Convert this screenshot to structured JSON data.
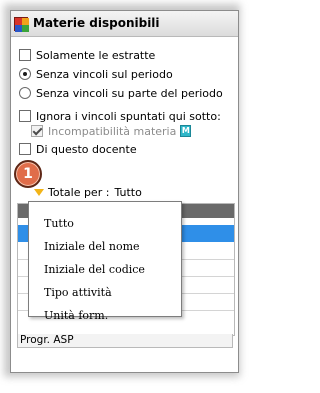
{
  "window": {
    "title": "Materie disponibili",
    "icon": "app-grid-icon"
  },
  "options": {
    "only_drawn": {
      "label": "Solamente le estratte",
      "checked": false
    },
    "radio_period": {
      "label": "Senza vincoli sul periodo",
      "selected": true
    },
    "radio_part_period": {
      "label": "Senza vincoli su parte del periodo",
      "selected": false
    },
    "ignore_constraints": {
      "label": "Ignora i vincoli spuntati qui sotto:",
      "checked": false
    },
    "incompatibility": {
      "label": "Incompatibilità materia",
      "checked": true,
      "enabled": false,
      "badge": "M"
    },
    "this_teacher": {
      "label": "Di questo docente",
      "checked": false
    }
  },
  "callout": {
    "number": "1"
  },
  "totals": {
    "label": "Totale per :",
    "value": "Tutto",
    "icon": "dropdown-triangle-icon"
  },
  "dropdown": {
    "items": [
      "Tutto",
      "Iniziale del nome",
      "Iniziale del codice",
      "Tipo attività",
      "Unità form."
    ]
  },
  "grid": {
    "bottom_row": "Progr. ASP"
  },
  "colors": {
    "selection": "#2f8fe8",
    "header": "#6a6a6a",
    "callout": "#e06d4a",
    "triangle": "#f2b418",
    "badge": "#2fb7c9"
  }
}
